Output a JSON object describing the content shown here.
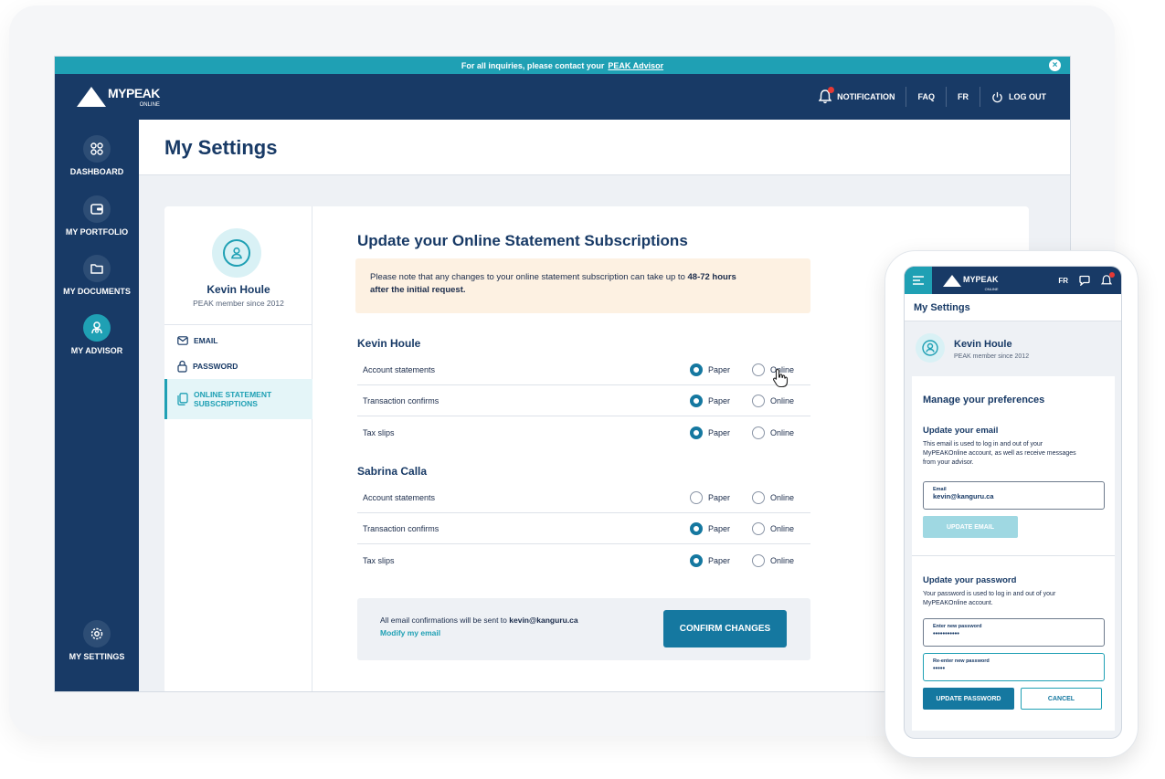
{
  "notice": {
    "text": "For all inquiries, please contact your",
    "link": "PEAK Advisor",
    "close": "×"
  },
  "brand": {
    "name": "MYPEAK",
    "sub": "ONLINE"
  },
  "topnav": {
    "notification": "NOTIFICATION",
    "faq": "FAQ",
    "lang": "FR",
    "logout": "LOG OUT"
  },
  "sidebar": {
    "items": [
      {
        "label": "DASHBOARD",
        "icon": "grid-icon"
      },
      {
        "label": "MY PORTFOLIO",
        "icon": "wallet-icon"
      },
      {
        "label": "MY DOCUMENTS",
        "icon": "folder-icon"
      },
      {
        "label": "MY ADVISOR",
        "icon": "advisor-icon"
      },
      {
        "label": "MY SETTINGS",
        "icon": "gear-icon"
      }
    ]
  },
  "page": {
    "title": "My Settings"
  },
  "profile": {
    "name": "Kevin Houle",
    "since": "PEAK member since 2012",
    "menu": [
      "EMAIL",
      "PASSWORD",
      "ONLINE STATEMENT",
      "SUBSCRIPTIONS"
    ]
  },
  "subscriptions": {
    "title": "Update your Online Statement Subscriptions",
    "notice_pre": "Please note that any changes to your online statement subscription can take up to ",
    "notice_bold": "48-72 hours",
    "notice_line2": "after the initial request.",
    "paper_label": "Paper",
    "online_label": "Online",
    "members": [
      {
        "name": "Kevin Houle",
        "rows": [
          {
            "label": "Account statements",
            "selected": "paper"
          },
          {
            "label": "Transaction confirms",
            "selected": "paper"
          },
          {
            "label": "Tax slips",
            "selected": "paper"
          }
        ]
      },
      {
        "name": "Sabrina Calla",
        "rows": [
          {
            "label": "Account statements",
            "selected": "none"
          },
          {
            "label": "Transaction confirms",
            "selected": "paper"
          },
          {
            "label": "Tax slips",
            "selected": "paper"
          }
        ]
      }
    ],
    "footer_text": "All email confirmations will be sent to",
    "footer_email": "kevin@kanguru.ca",
    "modify_link": "Modify my email",
    "confirm_button": "CONFIRM CHANGES"
  },
  "mobile": {
    "brand": "MYPEAK",
    "brand_sub": "ONLINE",
    "lang": "FR",
    "title": "My Settings",
    "name": "Kevin Houle",
    "since": "PEAK member since 2012",
    "manage_title": "Manage your preferences",
    "email_title": "Update your email",
    "email_desc": "This email is used to log in and out of your MyPEAKOnline account, as well as receive messages from your advisor.",
    "email_field_label": "Email",
    "email_value": "kevin@kanguru.ca",
    "update_email_button": "UPDATE EMAIL",
    "password_title": "Update your password",
    "password_desc": "Your password is used to log in and out of your MyPEAKOnline account.",
    "new_pw_label": "Enter new password",
    "new_pw_value": "•••••••••••",
    "re_pw_label": "Re-enter new password",
    "re_pw_value": "•••••",
    "update_pw_button": "UPDATE PASSWORD",
    "cancel_button": "CANCEL"
  },
  "colors": {
    "navy": "#183a66",
    "teal": "#1fa0b4",
    "button": "#1578a0",
    "notice_bg": "#fdf1e2"
  }
}
